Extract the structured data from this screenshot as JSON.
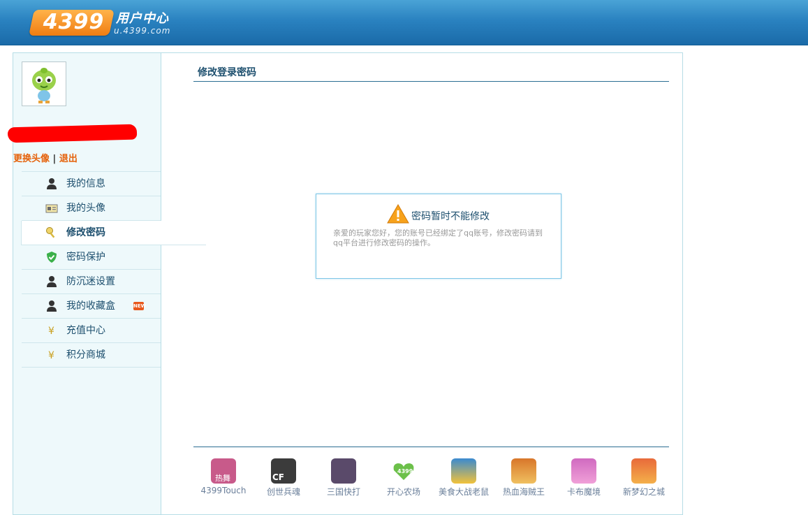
{
  "header": {
    "logo_number": "4399",
    "logo_title": "用户中心",
    "logo_url": "u.4399.com"
  },
  "sidebar": {
    "change_avatar": "更换头像",
    "separator": "|",
    "logout": "退出",
    "items": [
      {
        "label": "我的信息",
        "icon": "user-icon"
      },
      {
        "label": "我的头像",
        "icon": "id-card-icon"
      },
      {
        "label": "修改密码",
        "icon": "key-icon",
        "active": true
      },
      {
        "label": "密码保护",
        "icon": "shield-check-icon"
      },
      {
        "label": "防沉迷设置",
        "icon": "user-icon"
      },
      {
        "label": "我的收藏盒",
        "icon": "user-icon",
        "badge": "NEW"
      },
      {
        "label": "充值中心",
        "icon": "yen-icon"
      },
      {
        "label": "积分商城",
        "icon": "yen-icon"
      }
    ]
  },
  "content": {
    "title": "修改登录密码",
    "notice": {
      "title": "密码暂时不能修改",
      "body": "亲爱的玩家您好，您的账号已经绑定了qq账号，修改密码请到qq平台进行修改密码的操作。"
    }
  },
  "games": [
    {
      "label": "4399Touch",
      "icon_text": "热舞",
      "color": "#c85a8a"
    },
    {
      "label": "创世兵魂",
      "icon_text": "CF",
      "color": "#3b3b3b"
    },
    {
      "label": "三国快打",
      "icon_text": "",
      "color": "#5a4a6a"
    },
    {
      "label": "开心农场",
      "icon_text": "4399",
      "color": "#6cc04a"
    },
    {
      "label": "美食大战老鼠",
      "icon_text": "",
      "color": "#3a8ad0"
    },
    {
      "label": "热血海贼王",
      "icon_text": "",
      "color": "#d8762a"
    },
    {
      "label": "卡布魔境",
      "icon_text": "",
      "color": "#d06ac0"
    },
    {
      "label": "新梦幻之城",
      "icon_text": "",
      "color": "#e86a3a"
    }
  ],
  "colors": {
    "accent": "#1d4f6e",
    "link_orange": "#e5610a",
    "header_blue": "#2a82c0"
  }
}
